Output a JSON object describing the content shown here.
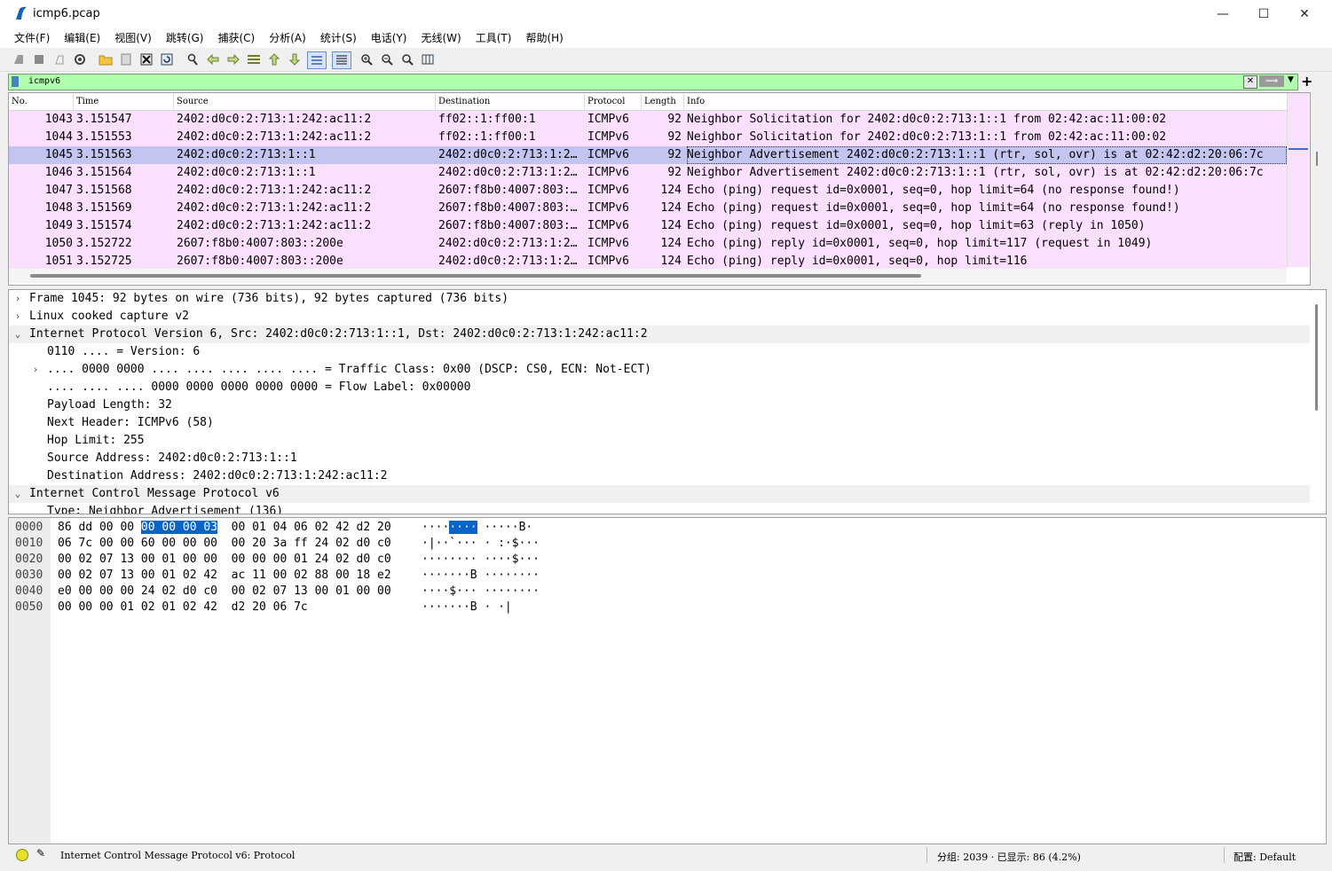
{
  "window": {
    "title": "icmp6.pcap",
    "minimize": "—",
    "maximize": "☐",
    "close": "✕"
  },
  "menu": [
    "文件(F)",
    "编辑(E)",
    "视图(V)",
    "跳转(G)",
    "捕获(C)",
    "分析(A)",
    "统计(S)",
    "电话(Y)",
    "无线(W)",
    "工具(T)",
    "帮助(H)"
  ],
  "toolbar": {
    "icons": [
      "start-capture-icon",
      "stop-capture-icon",
      "restart-capture-icon",
      "capture-options-icon",
      "open-file-icon",
      "save-file-icon",
      "close-file-icon",
      "reload-file-icon",
      "find-packet-icon",
      "go-back-icon",
      "go-forward-icon",
      "go-to-packet-icon",
      "go-first-icon",
      "go-last-icon",
      "autoscroll-icon",
      "colorize-icon",
      "zoom-in-icon",
      "zoom-out-icon",
      "zoom-normal-icon",
      "resize-columns-icon"
    ]
  },
  "filter": {
    "value": "icmpv6",
    "clear_glyph": "✕",
    "apply_glyph": "⟹",
    "dropdown_glyph": "▼",
    "add_glyph": "+"
  },
  "packet_list": {
    "columns": [
      "No.",
      "Time",
      "Source",
      "Destination",
      "Protocol",
      "Length",
      "Info"
    ],
    "rows": [
      {
        "no": "1043",
        "time": "3.151547",
        "src": "2402:d0c0:2:713:1:242:ac11:2",
        "dst": "ff02::1:ff00:1",
        "proto": "ICMPv6",
        "len": "92",
        "info": "Neighbor Solicitation for 2402:d0c0:2:713:1::1 from 02:42:ac:11:00:02"
      },
      {
        "no": "1044",
        "time": "3.151553",
        "src": "2402:d0c0:2:713:1:242:ac11:2",
        "dst": "ff02::1:ff00:1",
        "proto": "ICMPv6",
        "len": "92",
        "info": "Neighbor Solicitation for 2402:d0c0:2:713:1::1 from 02:42:ac:11:00:02"
      },
      {
        "no": "1045",
        "time": "3.151563",
        "src": "2402:d0c0:2:713:1::1",
        "dst": "2402:d0c0:2:713:1:2…",
        "proto": "ICMPv6",
        "len": "92",
        "info": "Neighbor Advertisement 2402:d0c0:2:713:1::1 (rtr, sol, ovr) is at 02:42:d2:20:06:7c"
      },
      {
        "no": "1046",
        "time": "3.151564",
        "src": "2402:d0c0:2:713:1::1",
        "dst": "2402:d0c0:2:713:1:2…",
        "proto": "ICMPv6",
        "len": "92",
        "info": "Neighbor Advertisement 2402:d0c0:2:713:1::1 (rtr, sol, ovr) is at 02:42:d2:20:06:7c"
      },
      {
        "no": "1047",
        "time": "3.151568",
        "src": "2402:d0c0:2:713:1:242:ac11:2",
        "dst": "2607:f8b0:4007:803:…",
        "proto": "ICMPv6",
        "len": "124",
        "info": "Echo (ping) request id=0x0001, seq=0, hop limit=64 (no response found!)"
      },
      {
        "no": "1048",
        "time": "3.151569",
        "src": "2402:d0c0:2:713:1:242:ac11:2",
        "dst": "2607:f8b0:4007:803:…",
        "proto": "ICMPv6",
        "len": "124",
        "info": "Echo (ping) request id=0x0001, seq=0, hop limit=64 (no response found!)"
      },
      {
        "no": "1049",
        "time": "3.151574",
        "src": "2402:d0c0:2:713:1:242:ac11:2",
        "dst": "2607:f8b0:4007:803:…",
        "proto": "ICMPv6",
        "len": "124",
        "info": "Echo (ping) request id=0x0001, seq=0, hop limit=63 (reply in 1050)"
      },
      {
        "no": "1050",
        "time": "3.152722",
        "src": "2607:f8b0:4007:803::200e",
        "dst": "2402:d0c0:2:713:1:2…",
        "proto": "ICMPv6",
        "len": "124",
        "info": "Echo (ping) reply id=0x0001, seq=0, hop limit=117 (request in 1049)"
      },
      {
        "no": "1051",
        "time": "3.152725",
        "src": "2607:f8b0:4007:803::200e",
        "dst": "2402:d0c0:2:713:1:2…",
        "proto": "ICMPv6",
        "len": "124",
        "info": "Echo (ping) reply id=0x0001, seq=0, hop limit=116"
      }
    ],
    "selected_index": 2
  },
  "details": {
    "rows": [
      {
        "level": 0,
        "arrow": "›",
        "text": "Frame 1045: 92 bytes on wire (736 bits), 92 bytes captured (736 bits)"
      },
      {
        "level": 0,
        "arrow": "›",
        "text": "Linux cooked capture v2"
      },
      {
        "level": 0,
        "arrow": "⌄",
        "text": "Internet Protocol Version 6, Src: 2402:d0c0:2:713:1::1, Dst: 2402:d0c0:2:713:1:242:ac11:2"
      },
      {
        "level": 1,
        "arrow": "",
        "text": "0110 .... = Version: 6"
      },
      {
        "level": 1,
        "arrow": "›",
        "text": ".... 0000 0000 .... .... .... .... .... = Traffic Class: 0x00 (DSCP: CS0, ECN: Not-ECT)"
      },
      {
        "level": 1,
        "arrow": "",
        "text": ".... .... .... 0000 0000 0000 0000 0000 = Flow Label: 0x00000"
      },
      {
        "level": 1,
        "arrow": "",
        "text": "Payload Length: 32"
      },
      {
        "level": 1,
        "arrow": "",
        "text": "Next Header: ICMPv6 (58)"
      },
      {
        "level": 1,
        "arrow": "",
        "text": "Hop Limit: 255"
      },
      {
        "level": 1,
        "arrow": "",
        "text": "Source Address: 2402:d0c0:2:713:1::1"
      },
      {
        "level": 1,
        "arrow": "",
        "text": "Destination Address: 2402:d0c0:2:713:1:242:ac11:2"
      },
      {
        "level": 0,
        "arrow": "⌄",
        "text": "Internet Control Message Protocol v6"
      },
      {
        "level": 1,
        "arrow": "",
        "text": "Type: Neighbor Advertisement (136)"
      }
    ]
  },
  "bytes": {
    "rows": [
      {
        "offset": "0000",
        "hex_pre": "86 dd 00 00 ",
        "hex_sel": "00 00 00 03",
        "hex_post": "  00 01 04 06 02 42 d2 20",
        "asc_pre": "····",
        "asc_sel": "····",
        "asc_post": " ·····B·"
      },
      {
        "offset": "0010",
        "hex_pre": "06 7c 00 00 60 00 00 00  00 20 3a ff 24 02 d0 c0",
        "hex_sel": "",
        "hex_post": "",
        "asc_pre": "·|··`··· · :·$···",
        "asc_sel": "",
        "asc_post": ""
      },
      {
        "offset": "0020",
        "hex_pre": "00 02 07 13 00 01 00 00  00 00 00 01 24 02 d0 c0",
        "hex_sel": "",
        "hex_post": "",
        "asc_pre": "········ ····$···",
        "asc_sel": "",
        "asc_post": ""
      },
      {
        "offset": "0030",
        "hex_pre": "00 02 07 13 00 01 02 42  ac 11 00 02 88 00 18 e2",
        "hex_sel": "",
        "hex_post": "",
        "asc_pre": "·······B ········",
        "asc_sel": "",
        "asc_post": ""
      },
      {
        "offset": "0040",
        "hex_pre": "e0 00 00 00 24 02 d0 c0  00 02 07 13 00 01 00 00",
        "hex_sel": "",
        "hex_post": "",
        "asc_pre": "····$··· ········",
        "asc_sel": "",
        "asc_post": ""
      },
      {
        "offset": "0050",
        "hex_pre": "00 00 00 01 02 01 02 42  d2 20 06 7c",
        "hex_sel": "",
        "hex_post": "",
        "asc_pre": "·······B · ·|",
        "asc_sel": "",
        "asc_post": ""
      }
    ]
  },
  "status": {
    "text": "Internet Control Message Protocol v6: Protocol",
    "packets": "分组: 2039 · 已显示: 86 (4.2%)",
    "profile": "配置: Default",
    "edit_glyph": "✎"
  },
  "colors": {
    "packet_row": "#fce0ff",
    "selected_row": "#c4c4f0",
    "filter_bg": "#afffaf",
    "byte_highlight": "#0a64c8"
  }
}
